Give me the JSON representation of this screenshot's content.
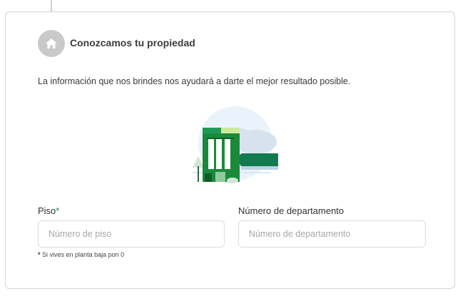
{
  "step": {
    "icon": "home-icon",
    "title": "Conozcamos tu propiedad",
    "description": "La información que nos brindes nos ayudará a darte el mejor resultado posible."
  },
  "illustration": {
    "icon": "building-illustration"
  },
  "fields": {
    "piso": {
      "label": "Piso",
      "required_mark": "*",
      "placeholder": "Número de piso",
      "hint_mark": "*",
      "hint": "Si vives en planta baja pon 0"
    },
    "departamento": {
      "label": "Número de departamento",
      "placeholder": "Número de departamento"
    }
  },
  "colors": {
    "accent_green": "#1e8c3c",
    "step_icon_bg": "#c9c9c9"
  }
}
